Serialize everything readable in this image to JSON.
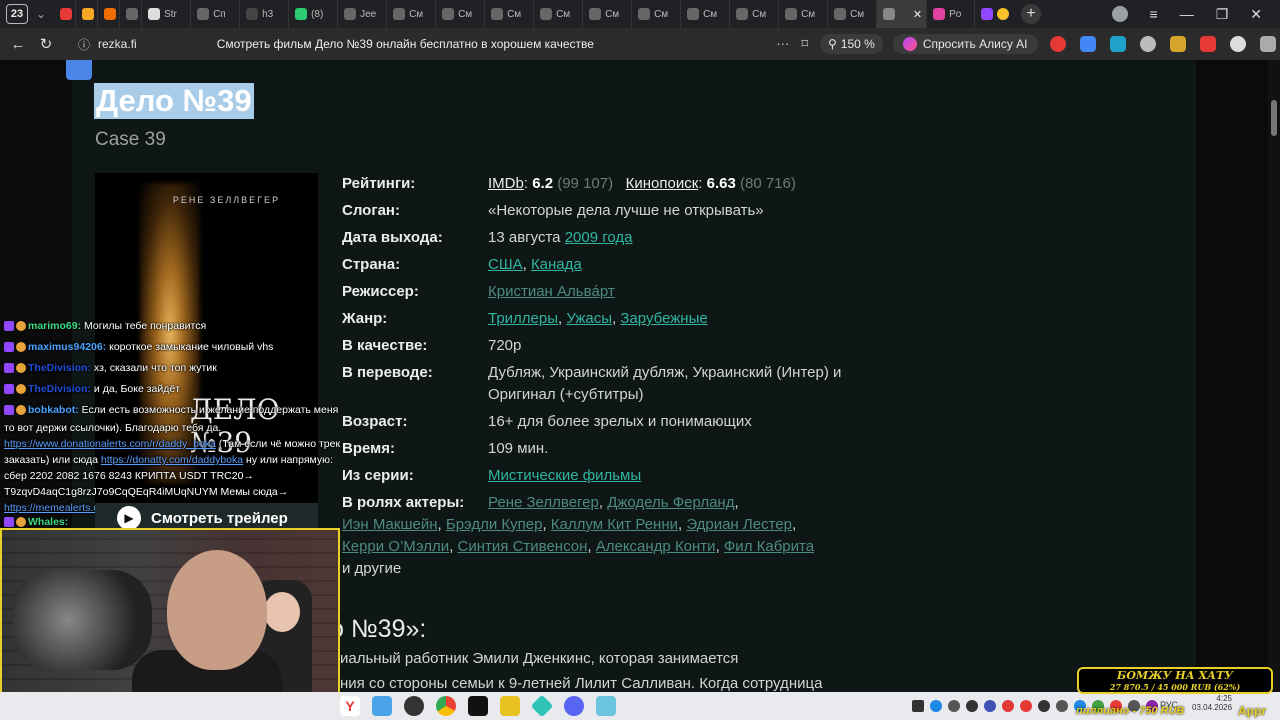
{
  "browser": {
    "tab_count": "23",
    "tabs": [
      {
        "label": "",
        "color": "#e53935"
      },
      {
        "label": "",
        "color": "#f9a825"
      },
      {
        "label": "",
        "color": "#ef6c00"
      },
      {
        "label": "",
        "color": "#666666"
      },
      {
        "label": "Str",
        "color": "#dddddd"
      },
      {
        "label": "Сп",
        "color": "#666666"
      },
      {
        "label": "h3",
        "color": "#444444"
      },
      {
        "label": "(8)",
        "color": "#2ecc71"
      },
      {
        "label": "Jee",
        "color": "#666666"
      },
      {
        "label": "См",
        "color": "#666666"
      },
      {
        "label": "См",
        "color": "#666666"
      },
      {
        "label": "См",
        "color": "#666666"
      },
      {
        "label": "См",
        "color": "#666666"
      },
      {
        "label": "См",
        "color": "#666666"
      },
      {
        "label": "См",
        "color": "#666666"
      },
      {
        "label": "См",
        "color": "#666666"
      },
      {
        "label": "См",
        "color": "#666666"
      },
      {
        "label": "См",
        "color": "#666666"
      },
      {
        "label": "См",
        "color": "#666666"
      }
    ],
    "active_tab_label": "",
    "extra_tab_label": "Po",
    "url_domain": "rezka.fi",
    "page_title": "Смотреть фильм Дело №39 онлайн бесплатно в хорошем качестве",
    "zoom": "150 %",
    "alice_label": "Спросить Алису AI"
  },
  "movie": {
    "title": "Дело №39",
    "original_title": "Case 39",
    "poster_actor": "РЕНЕ ЗЕЛЛВЕГЕР",
    "poster_title": "ДЕЛО №39",
    "trailer_label": "Смотреть трейлер",
    "ratings_label": "Рейтинги:",
    "imdb_label": "IMDb",
    "imdb_score": "6.2",
    "imdb_votes": "(99 107)",
    "kp_label": "Кинопоиск",
    "kp_score": "6.63",
    "kp_votes": "(80 716)",
    "slogan_label": "Слоган:",
    "slogan": "«Некоторые дела лучше не открывать»",
    "release_label": "Дата выхода:",
    "release_date": "13 августа",
    "release_year": "2009 года",
    "country_label": "Страна:",
    "country1": "США",
    "country2": "Канада",
    "director_label": "Режиссер:",
    "director": "Кристиан Альвáрт",
    "genre_label": "Жанр:",
    "genre1": "Триллеры",
    "genre2": "Ужасы",
    "genre3": "Зарубежные",
    "quality_label": "В качестве:",
    "quality": "720p",
    "translation_label": "В переводе:",
    "translation": "Дубляж, Украинский дубляж, Украинский (Интер) и Оригинал (+субтитры)",
    "age_label": "Возраст:",
    "age": "16+",
    "age_desc": "для более зрелых и понимающих",
    "time_label": "Время:",
    "time": "109 мин.",
    "series_label": "Из серии:",
    "series": "Мистические фильмы",
    "cast_label": "В ролях актеры:",
    "cast": [
      "Рене Зеллвегер",
      "Джодель Ферланд",
      "Иэн Макшейн",
      "Брэдли Купер",
      "Каллум Кит Ренни",
      "Эдриан Лестер",
      "Керри О’Мэлли",
      "Синтия Стивенсон",
      "Александр Конти",
      "Фил Кабрита"
    ],
    "cast_more": "и другие",
    "desc_title": "о №39»:",
    "desc_line1": "иальный работник Эмили Дженкинс, которая занимается",
    "desc_line2": "ния со стороны семьи к 9-летней Лилит Салливан. Когда сотрудница"
  },
  "chat": [
    {
      "nick": "marimo69",
      "nick_color": "#3ddc84",
      "text": "Могилы тебе понравится"
    },
    {
      "nick": "maximus94206",
      "nick_color": "#4aa3ff",
      "text": "короткое замыкание чиловый vhs"
    },
    {
      "nick": "TheDivision",
      "nick_color": "#1e4dd8",
      "text": "хз, сказали что топ жутик"
    },
    {
      "nick": "TheDivision",
      "nick_color": "#1e4dd8",
      "text": "и да, Боке зайдёт"
    },
    {
      "nick": "bobkabot",
      "nick_color": "#4aa3ff",
      "text": "Если есть возможность и желание поддержать меня"
    },
    {
      "line": "то вот держи ссылочки). Благодарю тебя да."
    },
    {
      "link": "https://www.donationalerts.com/r/daddy_boka",
      "text": "(Там если чё можно трек"
    },
    {
      "prefix": "заказать) или сюда",
      "link": "https://donatty.com/daddyboka",
      "text": "ну или напрямую:"
    },
    {
      "line": "сбер 2202 2082 1676 8243 КРИПТА USDT TRC20→"
    },
    {
      "line": "T9zqvD4aqC1g8rzJ7o9CqQEqR4iMUqNUYM Мемы сюда→"
    },
    {
      "link": "https://memealerts.com/6533eb50eedcf58a20185b7c"
    },
    {
      "nick": "Whales",
      "nick_color": "#3ddc84",
      "text": ""
    }
  ],
  "taskbar": {
    "lang": "РУС",
    "time": "4:25",
    "date": "03.04.2026"
  },
  "donation": {
    "title": "БОМЖУ НА ХАТУ",
    "progress": "27 870.5 / 45 000 RUB (62%)",
    "progress_fraction": 0.62,
    "ticker": "пиллиано - 750 RUB",
    "appr": "Appr"
  }
}
